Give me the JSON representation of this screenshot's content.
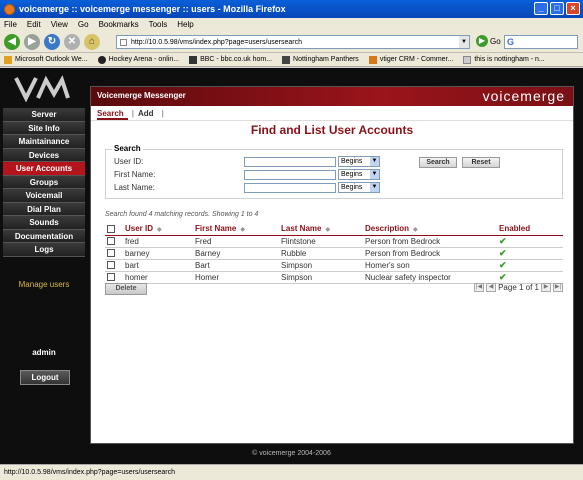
{
  "window": {
    "title": "voicemerge :: voicemerge messenger :: users - Mozilla Firefox"
  },
  "menu": [
    "File",
    "Edit",
    "View",
    "Go",
    "Bookmarks",
    "Tools",
    "Help"
  ],
  "toolbar": {
    "url": "http://10.0.5.98/vms/index.php?page=users/usersearch",
    "go_label": "Go",
    "search_value": ""
  },
  "bookmarks": [
    {
      "label": "Microsoft Outlook We...",
      "color": "#e0a020"
    },
    {
      "label": "Hockey Arena - onlin...",
      "color": "#222222"
    },
    {
      "label": "BBC - bbc.co.uk hom...",
      "color": "#333333"
    },
    {
      "label": "Nottingham Panthers",
      "color": "#444444"
    },
    {
      "label": "vtiger CRM - Commer...",
      "color": "#d8761a"
    },
    {
      "label": "this is nottingham - n...",
      "color": "#cccccc"
    }
  ],
  "sidebar": {
    "items": [
      {
        "label": "Server",
        "active": false
      },
      {
        "label": "Site Info",
        "active": false
      },
      {
        "label": "Maintainance",
        "active": false
      },
      {
        "label": "Devices",
        "active": false
      },
      {
        "label": "User Accounts",
        "active": true
      },
      {
        "label": "Groups",
        "active": false
      },
      {
        "label": "Voicemail",
        "active": false
      },
      {
        "label": "Dial Plan",
        "active": false
      },
      {
        "label": "Sounds",
        "active": false
      },
      {
        "label": "Documentation",
        "active": false
      },
      {
        "label": "Logs",
        "active": false
      }
    ],
    "manage_users": "Manage users",
    "admin_label": "admin",
    "logout_label": "Logout"
  },
  "banner": {
    "left": "Voicemerge Messenger",
    "right": "voicemerge"
  },
  "tabs": [
    {
      "label": "Search",
      "active": true
    },
    {
      "label": "Add",
      "active": false
    }
  ],
  "heading": "Find and List User Accounts",
  "search": {
    "legend": "Search",
    "fields": [
      {
        "label": "User ID:",
        "mode": "Begins",
        "value": ""
      },
      {
        "label": "First Name:",
        "mode": "Begins",
        "value": ""
      },
      {
        "label": "Last Name:",
        "mode": "Begins",
        "value": ""
      }
    ],
    "search_button": "Search",
    "reset_button": "Reset"
  },
  "result_info": "Search found 4 matching records. Showing 1 to 4",
  "table": {
    "headers": [
      "User ID",
      "First Name",
      "Last Name",
      "Description",
      "Enabled"
    ],
    "rows": [
      {
        "user_id": "fred",
        "first": "Fred",
        "last": "Flintstone",
        "desc": "Person from Bedrock",
        "enabled": "✔"
      },
      {
        "user_id": "barney",
        "first": "Barney",
        "last": "Rubble",
        "desc": "Person from Bedrock",
        "enabled": "✔"
      },
      {
        "user_id": "bart",
        "first": "Bart",
        "last": "Simpson",
        "desc": "Homer's son",
        "enabled": "✔"
      },
      {
        "user_id": "homer",
        "first": "Homer",
        "last": "Simpson",
        "desc": "Nuclear safety inspector",
        "enabled": "✔"
      }
    ]
  },
  "delete_button": "Delete",
  "pager": {
    "text": "Page 1 of 1"
  },
  "footer": "© voicemerge 2004-2006",
  "status": "http://10.0.5.98/vms/index.php?page=users/usersearch"
}
